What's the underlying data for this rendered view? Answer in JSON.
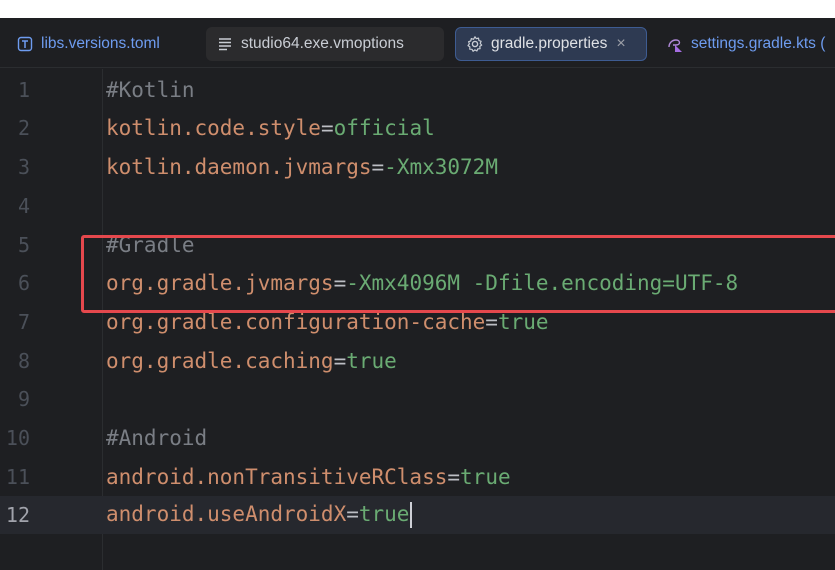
{
  "tabs": [
    {
      "label": "libs.versions.toml",
      "icon": "toml-file-icon",
      "state": "plain"
    },
    {
      "label": "studio64.exe.vmoptions",
      "icon": "text-file-icon",
      "state": "inactive"
    },
    {
      "label": "gradle.properties",
      "icon": "gear-icon",
      "state": "active",
      "close": "×"
    },
    {
      "label": "settings.gradle.kts (",
      "icon": "kotlin-gradle-file-icon",
      "state": "plain"
    }
  ],
  "lines": [
    {
      "num": "1",
      "comment": "#Kotlin"
    },
    {
      "num": "2",
      "key": "kotlin.code.style",
      "eq": "=",
      "val": "official"
    },
    {
      "num": "3",
      "key": "kotlin.daemon.jvmargs",
      "eq": "=",
      "val": "-Xmx3072M"
    },
    {
      "num": "4"
    },
    {
      "num": "5",
      "comment": "#Gradle"
    },
    {
      "num": "6",
      "key": "org.gradle.jvmargs",
      "eq": "=",
      "val": "-Xmx4096M -Dfile.encoding=UTF-8"
    },
    {
      "num": "7",
      "key": "org.gradle.configuration-cache",
      "eq": "=",
      "val": "true"
    },
    {
      "num": "8",
      "key": "org.gradle.caching",
      "eq": "=",
      "val": "true"
    },
    {
      "num": "9"
    },
    {
      "num": "10",
      "comment": "#Android"
    },
    {
      "num": "11",
      "key": "android.nonTransitiveRClass",
      "eq": "=",
      "val": "true"
    },
    {
      "num": "12",
      "key": "android.useAndroidX",
      "eq": "=",
      "val": "true"
    }
  ],
  "current_line": "12",
  "colors": {
    "background": "#1e1f22",
    "comment": "#7a7e85",
    "property_key": "#cf8e6d",
    "property_value": "#6aab73",
    "highlight_box": "#e5484d",
    "active_tab_border": "#3e5c92"
  }
}
